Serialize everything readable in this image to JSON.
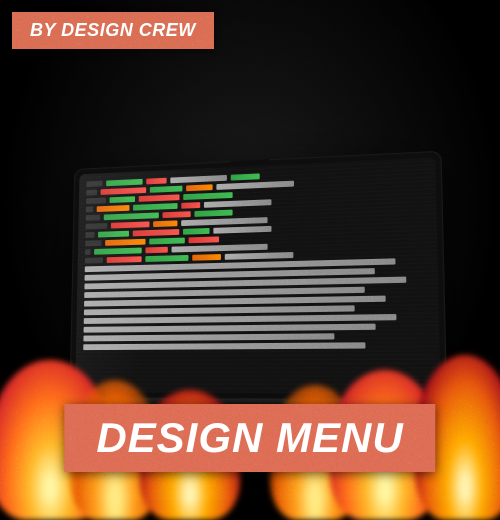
{
  "banners": {
    "top": "BY DESIGN CREW",
    "bottom": "DESIGN MENU"
  },
  "colors": {
    "banner_bg": "#dd6b54",
    "banner_text": "#ffffff"
  }
}
